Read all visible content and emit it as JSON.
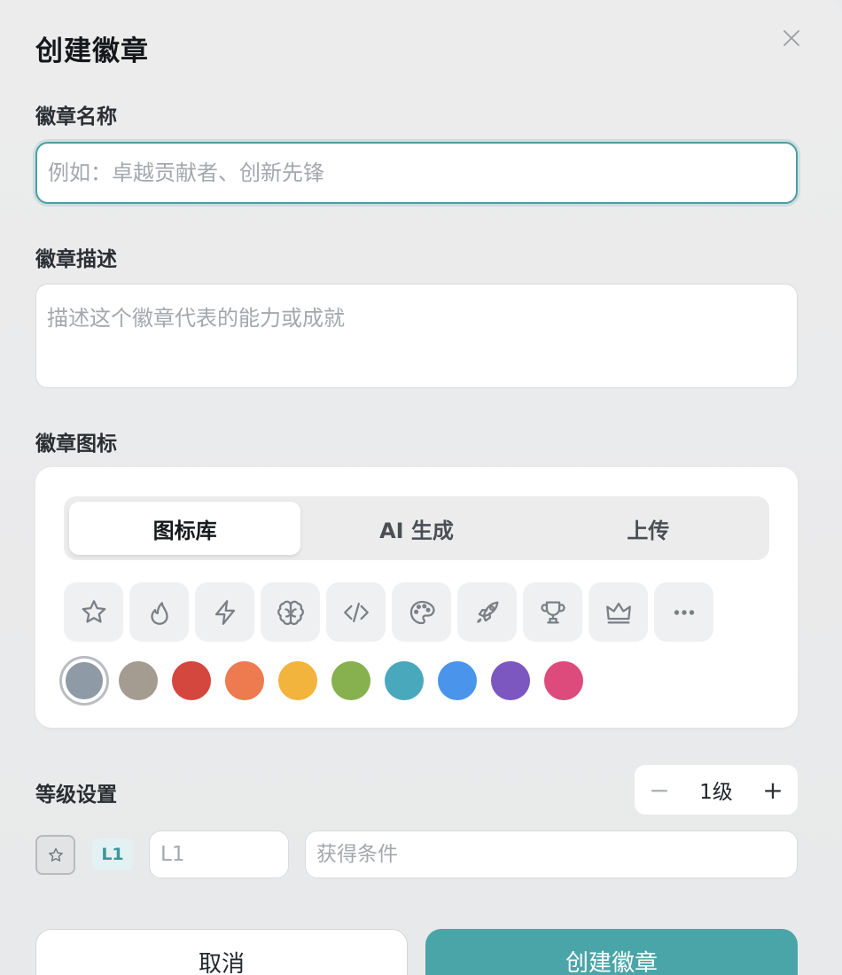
{
  "dialog": {
    "title": "创建徽章",
    "close_icon": "close-icon"
  },
  "name_field": {
    "label": "徽章名称",
    "value": "",
    "placeholder": "例如：卓越贡献者、创新先锋"
  },
  "description_field": {
    "label": "徽章描述",
    "value": "",
    "placeholder": "描述这个徽章代表的能力或成就"
  },
  "icon_section": {
    "label": "徽章图标",
    "tabs": [
      {
        "label": "图标库",
        "active": true
      },
      {
        "label": "AI 生成",
        "active": false
      },
      {
        "label": "上传",
        "active": false
      }
    ],
    "icons": [
      "star-icon",
      "flame-icon",
      "lightning-icon",
      "brain-icon",
      "code-icon",
      "palette-icon",
      "rocket-icon",
      "trophy-icon",
      "crown-icon",
      "more-icon"
    ],
    "colors": [
      "#8e9aa6",
      "#a59c91",
      "#d4473f",
      "#ee7a4f",
      "#f2b43d",
      "#87b04e",
      "#4aa8bd",
      "#4a94eb",
      "#7c57c0",
      "#dd4b7d"
    ],
    "selected_color_index": 0
  },
  "level_section": {
    "label": "等级设置",
    "level_value": "1级",
    "minus_label": "−",
    "plus_label": "+",
    "rows": [
      {
        "badge": "L1",
        "name_value": "",
        "name_placeholder": "L1",
        "condition_value": "",
        "condition_placeholder": "获得条件"
      }
    ]
  },
  "footer": {
    "cancel_label": "取消",
    "submit_label": "创建徽章"
  }
}
